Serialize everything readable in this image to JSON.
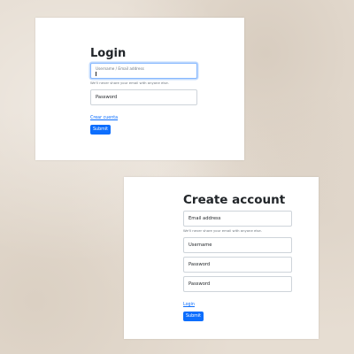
{
  "login": {
    "title": "Login",
    "user_field_placeholder": "Username / Email address",
    "help_text": "We'll never share your email with anyone else.",
    "password_placeholder": "Password",
    "create_link": "Crear cuenta",
    "submit_label": "Submit"
  },
  "create": {
    "title": "Create account",
    "email_placeholder": "Email address",
    "help_text": "We'll never share your email with anyone else.",
    "username_placeholder": "Username",
    "password_placeholder": "Password",
    "password_confirm_placeholder": "Password",
    "login_link": "Login",
    "submit_label": "Submit"
  },
  "colors": {
    "primary": "#0d6efd",
    "focus_border": "#86b7fe",
    "background": "#e6ddd2"
  }
}
